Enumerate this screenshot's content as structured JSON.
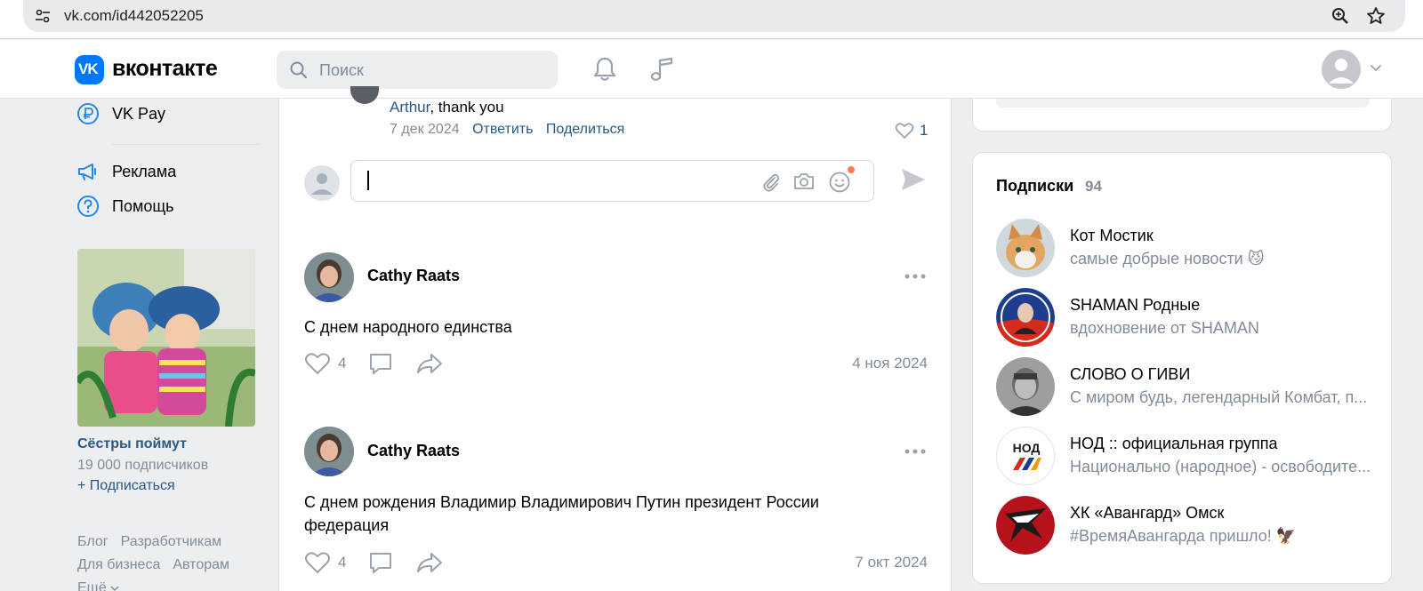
{
  "browser": {
    "url": "vk.com/id442052205"
  },
  "header": {
    "brand": "вконтакте",
    "logo_text": "VK",
    "search_placeholder": "Поиск"
  },
  "sidebar": {
    "items": [
      {
        "label": "VK Pay",
        "icon": "vk-pay-icon"
      },
      {
        "label": "Реклама",
        "icon": "megaphone-icon"
      },
      {
        "label": "Помощь",
        "icon": "help-icon"
      }
    ],
    "ad": {
      "title": "Сёстры поймут",
      "subscribers": "19 000 подписчиков",
      "subscribe": "+ Подписаться"
    },
    "footer_row1": [
      "Блог",
      "Разработчикам"
    ],
    "footer_row2": [
      "Для бизнеса",
      "Авторам"
    ],
    "footer_more": "Ещё"
  },
  "feed": {
    "reply": {
      "author": "Arthur",
      "text": ", thank you",
      "date": "7 дек 2024",
      "reply_label": "Ответить",
      "share_label": "Поделиться",
      "likes": "1"
    },
    "comment_input": {
      "placeholder": ""
    },
    "posts": [
      {
        "author": "Cathy Raats",
        "text": "С днем народного единства",
        "likes": "4",
        "date": "4 ноя 2024"
      },
      {
        "author": "Cathy Raats",
        "text": "С днем рождения Владимир Владимирович Путин президент России федерация",
        "likes": "4",
        "date": "7 окт 2024"
      }
    ]
  },
  "subscriptions": {
    "title": "Подписки",
    "count": "94",
    "items": [
      {
        "name": "Кот Мостик",
        "desc": "самые добрые новости 😼",
        "color": "#d9a066"
      },
      {
        "name": "SHAMAN Родные",
        "desc": "вдохновение от SHAMAN",
        "color": "#1d3d8f"
      },
      {
        "name": "СЛОВО О ГИВИ",
        "desc": "С миром будь, легендарный Комбат, п...",
        "color": "#5b5b5b"
      },
      {
        "name": "НОД :: официальная группа",
        "desc": "Национально (народное) - освободите...",
        "color": "#ffffff"
      },
      {
        "name": "ХК «Авангард» Омск",
        "desc": "#ВремяАвангарда пришло! 🦅",
        "color": "#b5121b"
      }
    ]
  },
  "colors": {
    "accent": "#0077ff",
    "link": "#2a5885",
    "muted": "#818c99",
    "background": "#edeef0"
  }
}
